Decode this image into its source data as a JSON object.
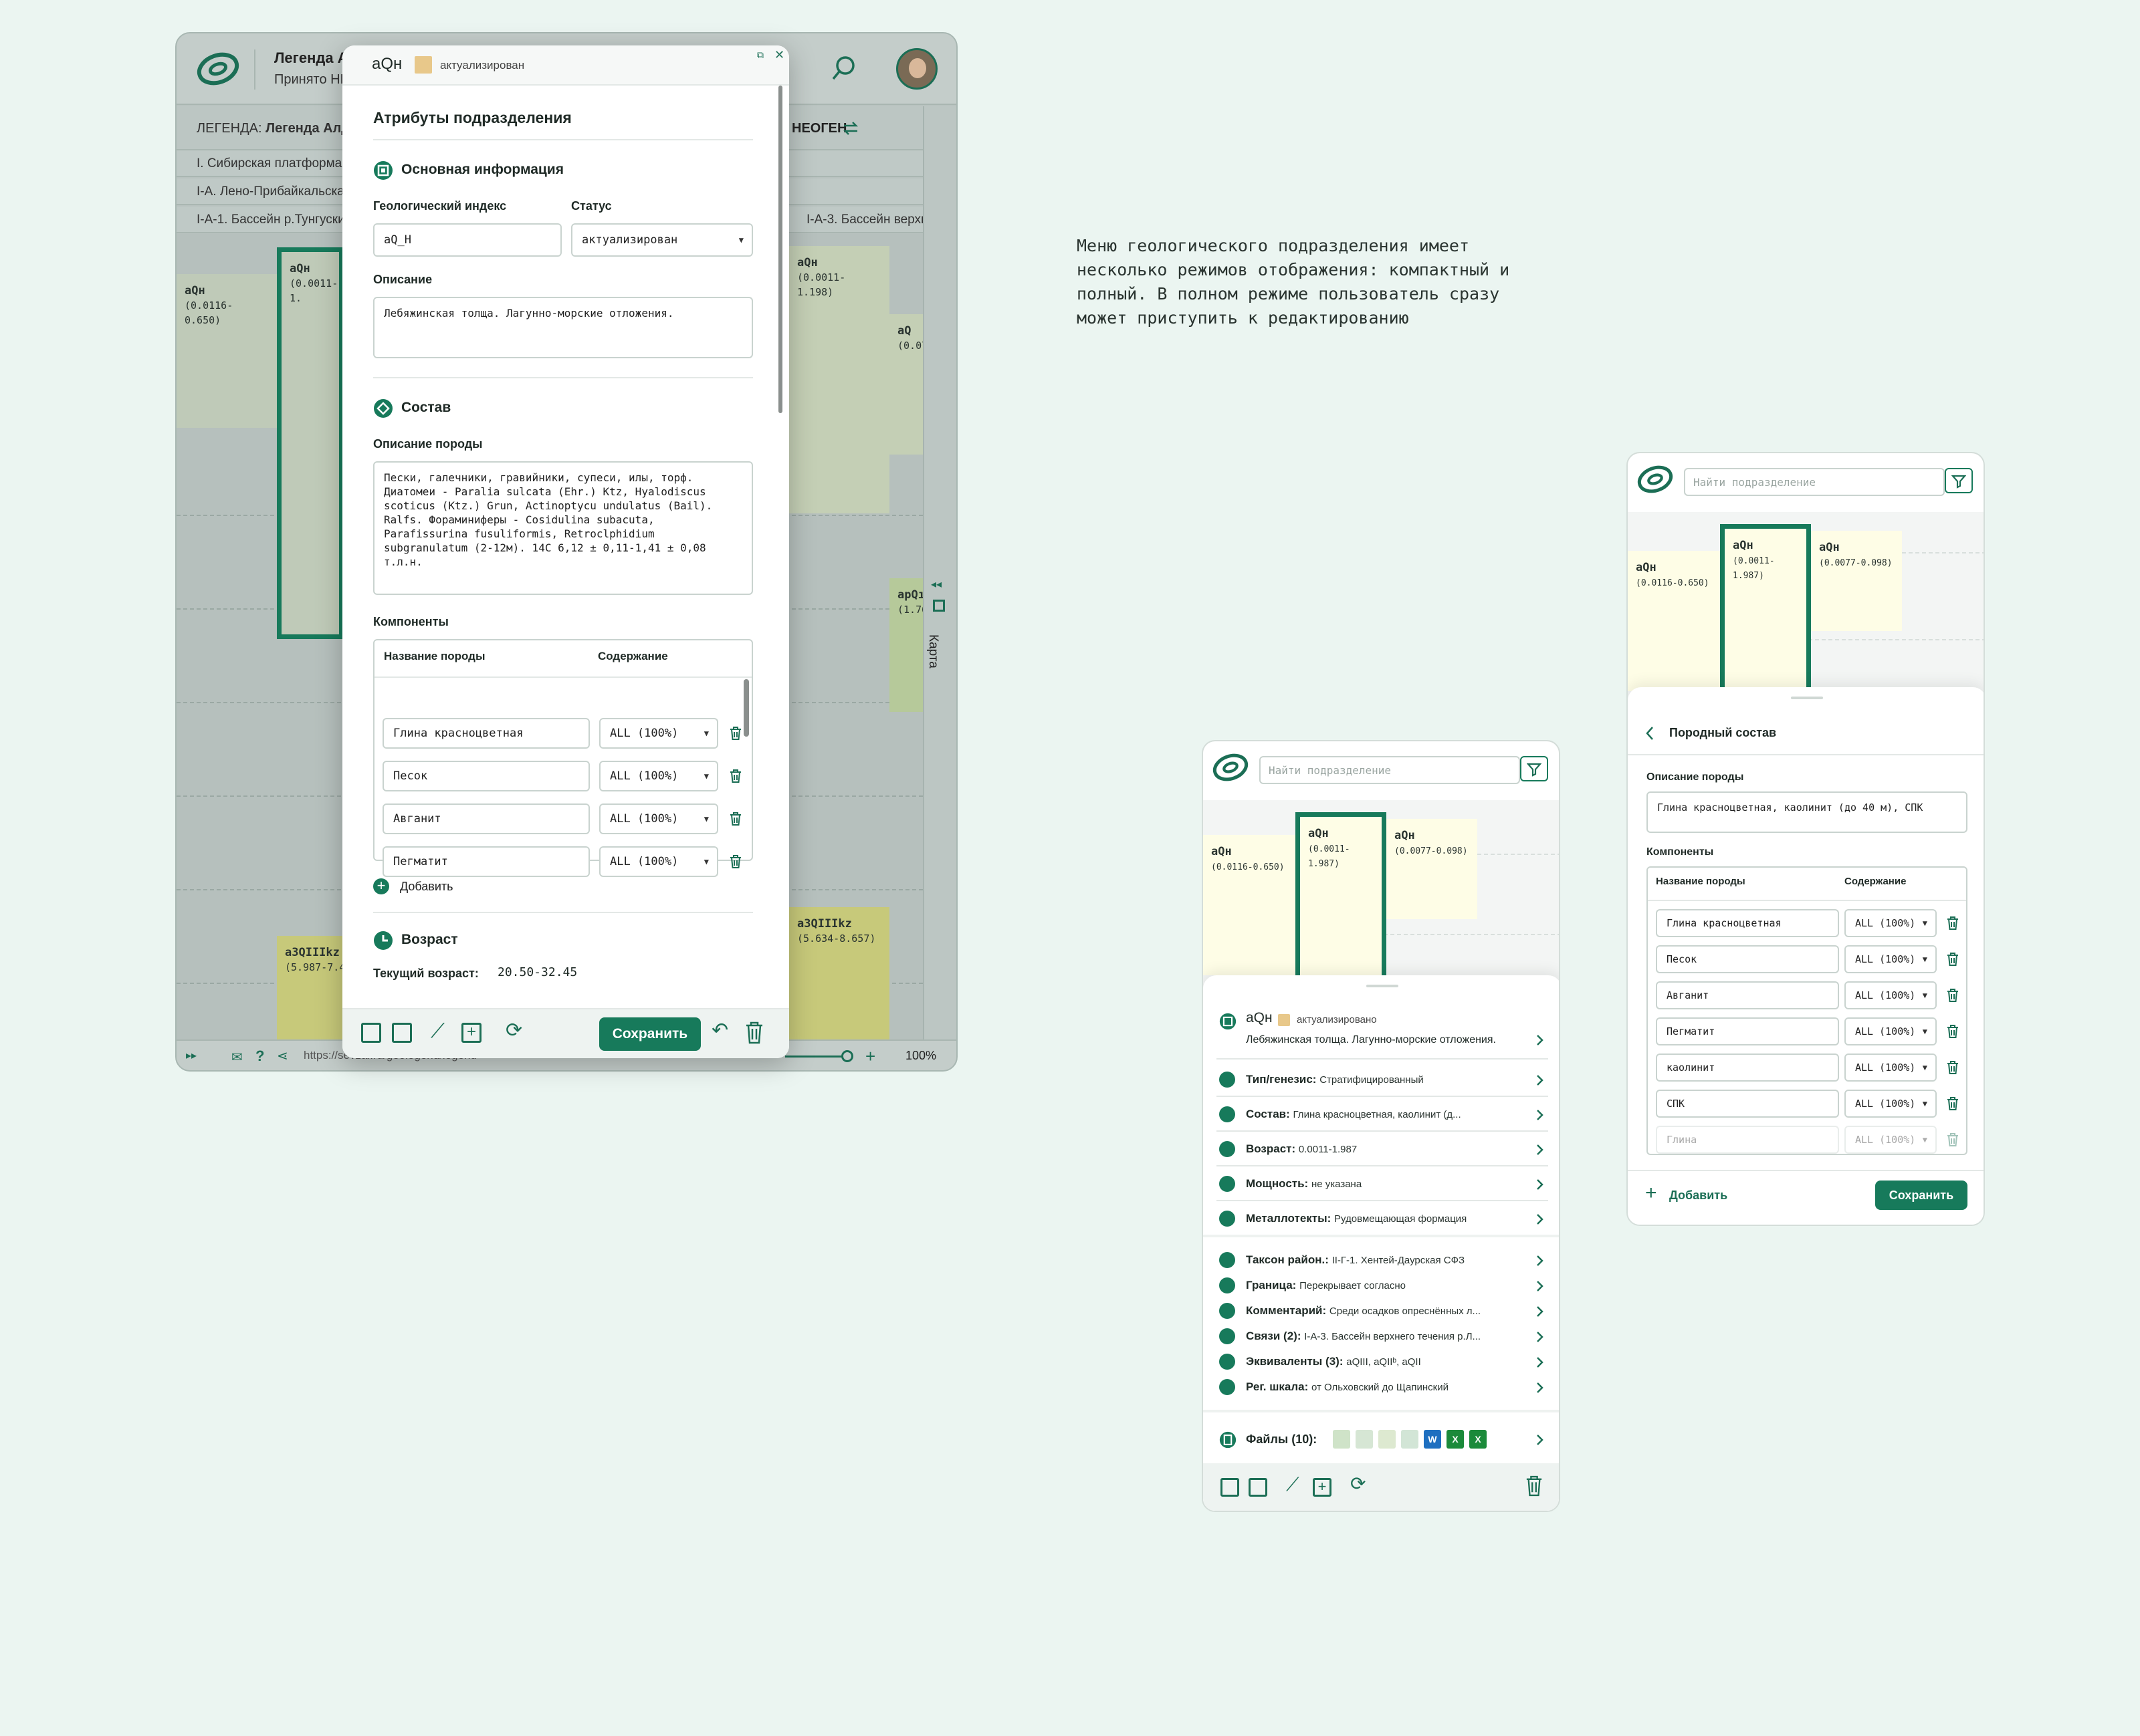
{
  "screen1": {
    "header": {
      "title": "Легенда А",
      "subtitle": "Принято НР"
    },
    "legend_bar": {
      "prefix": "ЛЕГЕНДА:",
      "name": "Легенда Алд",
      "right": "НЕОГЕН"
    },
    "legend_rows": [
      "I. Сибирская платформа",
      "I-A. Лено-Прибайкальска",
      "I-A-1. Бассейн р.Тунгуски",
      "I-A-3. Бассейн верхн"
    ],
    "units": [
      {
        "label": "aQн",
        "range": "(0.0116-0.650)"
      },
      {
        "label": "aQн",
        "range": "(0.0011-1."
      },
      {
        "label": "aQн",
        "range": "(0.0011-1.198)"
      },
      {
        "label": "aQ",
        "range": "(0.07"
      },
      {
        "label": "apQı",
        "range": "(1.76"
      },
      {
        "label": "a3QIIIkz",
        "range": "(5.987-7.4"
      },
      {
        "label": "a3QIIIkz",
        "range": "(5.634-8.657)"
      }
    ],
    "right_rail_label": "Карта",
    "bottom": {
      "url": "https://sevzal.ru/geolegend/legend",
      "zoom": "100%"
    }
  },
  "panel": {
    "index": "aQн",
    "status_chip": "актуализирован",
    "title": "Атрибуты подразделения",
    "basic": {
      "section": "Основная информация",
      "index_label": "Геологический индекс",
      "index_value": "aQ_H",
      "status_label": "Статус",
      "status_value": "актуализирован",
      "desc_label": "Описание",
      "desc_value": "Лебяжинская толща. Лагунно-морские отложения."
    },
    "composition": {
      "section": "Состав",
      "rock_desc_label": "Описание породы",
      "rock_desc_value": "Пески, галечники, гравийники, супеси, илы, торф. Диатомеи - Paralia sulcata (Ehr.) Ktz, Hyalodiscus scoticus (Ktz.) Grun, Actinoptycu undulatus (Bail). Ralfs. Фораминиферы - Cosidulina subacuta, Parafissurina fusuliformis, Retroclphidium subgranulatum (2-12м). 14C 6,12 ± 0,11-1,41 ± 0,08 т.л.н.",
      "components_label": "Компоненты",
      "col_name": "Название породы",
      "col_content": "Содержание",
      "components": [
        {
          "name": "Глина красноцветная",
          "content": "ALL (100%)"
        },
        {
          "name": "Песок",
          "content": "ALL (100%)"
        },
        {
          "name": "Авганит",
          "content": "ALL (100%)"
        },
        {
          "name": "Пегматит",
          "content": "ALL (100%)"
        }
      ],
      "add_label": "Добавить"
    },
    "age": {
      "section": "Возраст",
      "current_label": "Текущий возраст:",
      "current_value": "20.50-32.45"
    },
    "save_label": "Сохранить"
  },
  "description": "Меню геологического подразделения имеет несколько режимов отображения: компактный и полный. В полном режиме пользователь сразу может приступить к редактированию",
  "mobile_compact": {
    "search_placeholder": "Найти подразделение",
    "units": [
      {
        "label": "aQн",
        "range": "(0.0116-0.650)"
      },
      {
        "label": "aQн",
        "range": "(0.0011-1.987)"
      },
      {
        "label": "aQн",
        "range": "(0.0077-0.098)"
      }
    ],
    "summary": {
      "index": "aQн",
      "status": "актуализировано",
      "desc": "Лебяжинская толща. Лагунно-морские отложения."
    },
    "rows": [
      {
        "label": "Тип/генезис:",
        "value": "Стратифицированный"
      },
      {
        "label": "Состав:",
        "value": "Глина красноцветная, каолинит (д..."
      },
      {
        "label": "Возраст:",
        "value": "0.0011-1.987"
      },
      {
        "label": "Мощность:",
        "value": "не указана"
      },
      {
        "label": "Металлотекты:",
        "value": "Рудовмещающая формация"
      }
    ],
    "rows2": [
      {
        "label": "Таксон район.:",
        "value": "II-Г-1. Хентей-Даурская СФЗ"
      },
      {
        "label": "Граница:",
        "value": "Перекрывает согласно"
      },
      {
        "label": "Комментарий:",
        "value": "Среди осадков опреснённых л..."
      },
      {
        "label": "Связи (2):",
        "value": "I-А-3. Бассейн верхнего течения р.Л..."
      },
      {
        "label": "Эквиваленты (3):",
        "value": "aQIII, aQIIᵇ, aQII"
      },
      {
        "label": "Рег. шкала:",
        "value": "от Ольховский до Щапинский"
      }
    ],
    "files_label": "Файлы (10):",
    "file_badges": [
      "W",
      "X",
      "X"
    ]
  },
  "mobile_full": {
    "search_placeholder": "Найти подразделение",
    "units": [
      {
        "label": "aQн",
        "range": "(0.0116-0.650)"
      },
      {
        "label": "aQн",
        "range": "(0.0011-1.987)"
      },
      {
        "label": "aQн",
        "range": "(0.0077-0.098)"
      }
    ],
    "title": "Породный состав",
    "rock_desc_label": "Описание породы",
    "rock_desc_value": "Глина красноцветная, каолинит (до 40 м), СПК",
    "components_label": "Компоненты",
    "col_name": "Название породы",
    "col_content": "Содержание",
    "components": [
      {
        "name": "Глина красноцветная",
        "content": "ALL (100%)"
      },
      {
        "name": "Песок",
        "content": "ALL (100%)"
      },
      {
        "name": "Авганит",
        "content": "ALL (100%)"
      },
      {
        "name": "Пегматит",
        "content": "ALL (100%)"
      },
      {
        "name": "каолинит",
        "content": "ALL (100%)"
      },
      {
        "name": "СПК",
        "content": "ALL (100%)"
      },
      {
        "name": "Глина",
        "content": "ALL (100%)"
      }
    ],
    "add_label": "Добавить",
    "save_label": "Сохранить"
  }
}
